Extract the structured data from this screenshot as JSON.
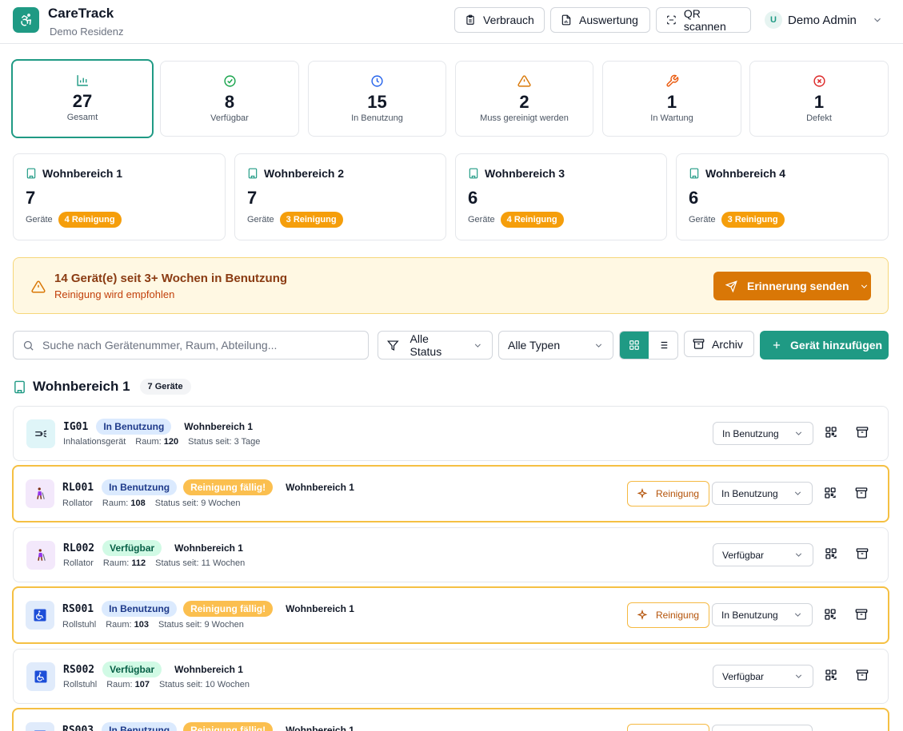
{
  "header": {
    "app_title": "CareTrack",
    "app_subtitle": "Demo Residenz",
    "btn_consumption": "Verbrauch",
    "btn_evaluation": "Auswertung",
    "btn_qr": "QR scannen",
    "user_initial": "U",
    "user_name": "Demo Admin"
  },
  "stats": [
    {
      "value": "27",
      "label": "Gesamt",
      "icon": "bar-chart-icon",
      "color": "#1f9a84"
    },
    {
      "value": "8",
      "label": "Verfügbar",
      "icon": "check-circle-icon",
      "color": "#16a34a"
    },
    {
      "value": "15",
      "label": "In Benutzung",
      "icon": "clock-icon",
      "color": "#2563eb"
    },
    {
      "value": "2",
      "label": "Muss gereinigt werden",
      "icon": "warning-icon",
      "color": "#d97706"
    },
    {
      "value": "1",
      "label": "In Wartung",
      "icon": "wrench-icon",
      "color": "#ea580c"
    },
    {
      "value": "1",
      "label": "Defekt",
      "icon": "x-circle-icon",
      "color": "#dc2626"
    }
  ],
  "areas": [
    {
      "name": "Wohnbereich 1",
      "count": "7",
      "devices_label": "Geräte",
      "cleaning": "4 Reinigung"
    },
    {
      "name": "Wohnbereich 2",
      "count": "7",
      "devices_label": "Geräte",
      "cleaning": "3 Reinigung"
    },
    {
      "name": "Wohnbereich 3",
      "count": "6",
      "devices_label": "Geräte",
      "cleaning": "4 Reinigung"
    },
    {
      "name": "Wohnbereich 4",
      "count": "6",
      "devices_label": "Geräte",
      "cleaning": "3 Reinigung"
    }
  ],
  "alert": {
    "title": "14 Gerät(e) seit 3+ Wochen in Benutzung",
    "subtitle": "Reinigung wird empfohlen",
    "button": "Erinnerung senden"
  },
  "toolbar": {
    "search_placeholder": "Suche nach Gerätenummer, Raum, Abteilung...",
    "status_filter": "Alle Status",
    "type_filter": "Alle Typen",
    "archive": "Archiv",
    "add_device": "Gerät hinzufügen"
  },
  "section": {
    "title": "Wohnbereich 1",
    "count": "7 Geräte"
  },
  "devices": [
    {
      "id": "IG01",
      "status": "In Benutzung",
      "status_kind": "use",
      "due": "",
      "area": "Wohnbereich 1",
      "type": "Inhalationsgerät",
      "room_label": "Raum:",
      "room": "120",
      "since": "Status seit: 3 Tage",
      "select": "In Benutzung",
      "icon": "inhaler-icon",
      "icon_bg": "#dff5f8"
    },
    {
      "id": "RL001",
      "status": "In Benutzung",
      "status_kind": "use",
      "due": "Reinigung fällig!",
      "area": "Wohnbereich 1",
      "type": "Rollator",
      "room_label": "Raum:",
      "room": "108",
      "since": "Status seit: 9 Wochen",
      "select": "In Benutzung",
      "clean_btn": "Reinigung",
      "icon": "walker-icon",
      "icon_bg": "#f3e8fb"
    },
    {
      "id": "RL002",
      "status": "Verfügbar",
      "status_kind": "ok",
      "due": "",
      "area": "Wohnbereich 1",
      "type": "Rollator",
      "room_label": "Raum:",
      "room": "112",
      "since": "Status seit: 11 Wochen",
      "select": "Verfügbar",
      "icon": "walker-icon",
      "icon_bg": "#f3e8fb"
    },
    {
      "id": "RS001",
      "status": "In Benutzung",
      "status_kind": "use",
      "due": "Reinigung fällig!",
      "area": "Wohnbereich 1",
      "type": "Rollstuhl",
      "room_label": "Raum:",
      "room": "103",
      "since": "Status seit: 9 Wochen",
      "select": "In Benutzung",
      "clean_btn": "Reinigung",
      "icon": "wheelchair-icon",
      "icon_bg": "#e0ebfb"
    },
    {
      "id": "RS002",
      "status": "Verfügbar",
      "status_kind": "ok",
      "due": "",
      "area": "Wohnbereich 1",
      "type": "Rollstuhl",
      "room_label": "Raum:",
      "room": "107",
      "since": "Status seit: 10 Wochen",
      "select": "Verfügbar",
      "icon": "wheelchair-icon",
      "icon_bg": "#e0ebfb"
    },
    {
      "id": "RS003",
      "status": "In Benutzung",
      "status_kind": "use",
      "due": "Reinigung fällig!",
      "area": "Wohnbereich 1",
      "type": "",
      "room_label": "",
      "room": "",
      "since": "",
      "select": "",
      "clean_btn": "",
      "icon": "wheelchair-icon",
      "icon_bg": "#e0ebfb"
    }
  ]
}
